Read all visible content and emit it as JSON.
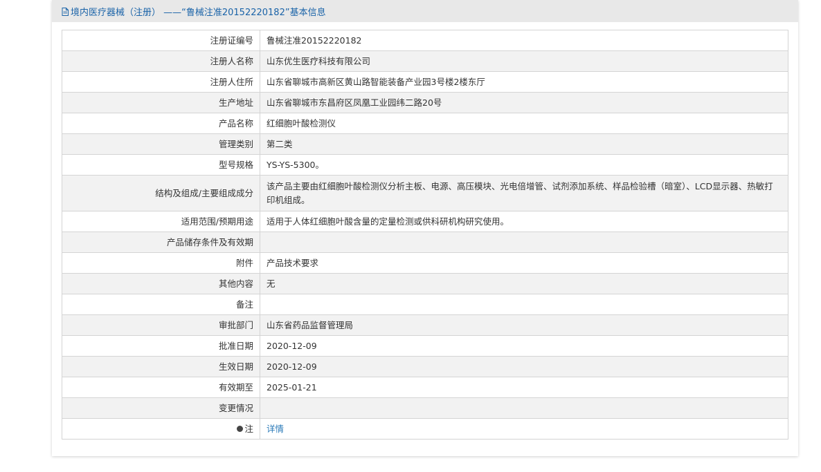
{
  "header": {
    "title": "境内医疗器械（注册） ——“鲁械注准20152220182”基本信息"
  },
  "rows": [
    {
      "label": "注册证编号",
      "value": "鲁械注准20152220182"
    },
    {
      "label": "注册人名称",
      "value": "山东优生医疗科技有限公司"
    },
    {
      "label": "注册人住所",
      "value": "山东省聊城市高新区黄山路智能装备产业园3号楼2楼东厅"
    },
    {
      "label": "生产地址",
      "value": "山东省聊城市东昌府区凤凰工业园纬二路20号"
    },
    {
      "label": "产品名称",
      "value": "红细胞叶酸检测仪"
    },
    {
      "label": "管理类别",
      "value": "第二类"
    },
    {
      "label": "型号规格",
      "value": "YS-YS-5300。"
    },
    {
      "label": "结构及组成/主要组成成分",
      "value": "该产品主要由红细胞叶酸检测仪分析主板、电源、高压模块、光电倍增管、试剂添加系统、样品检验槽（暗室）、LCD显示器、热敏打印机组成。"
    },
    {
      "label": "适用范围/预期用途",
      "value": "适用于人体红细胞叶酸含量的定量检测或供科研机构研究使用。"
    },
    {
      "label": "产品储存条件及有效期",
      "value": ""
    },
    {
      "label": "附件",
      "value": "产品技术要求"
    },
    {
      "label": "其他内容",
      "value": "无"
    },
    {
      "label": "备注",
      "value": ""
    },
    {
      "label": "审批部门",
      "value": "山东省药品监督管理局"
    },
    {
      "label": "批准日期",
      "value": "2020-12-09"
    },
    {
      "label": "生效日期",
      "value": "2020-12-09"
    },
    {
      "label": "有效期至",
      "value": "2025-01-21"
    },
    {
      "label": "变更情况",
      "value": ""
    }
  ],
  "note_row": {
    "label": "注",
    "icon": "bulb-icon",
    "link_text": "详情"
  },
  "colors": {
    "link": "#2a7ab8",
    "header_bg": "#e8e8e8",
    "header_text": "#1a63a8",
    "stripe": "#f2f2f2",
    "border": "#d4d4d4"
  }
}
